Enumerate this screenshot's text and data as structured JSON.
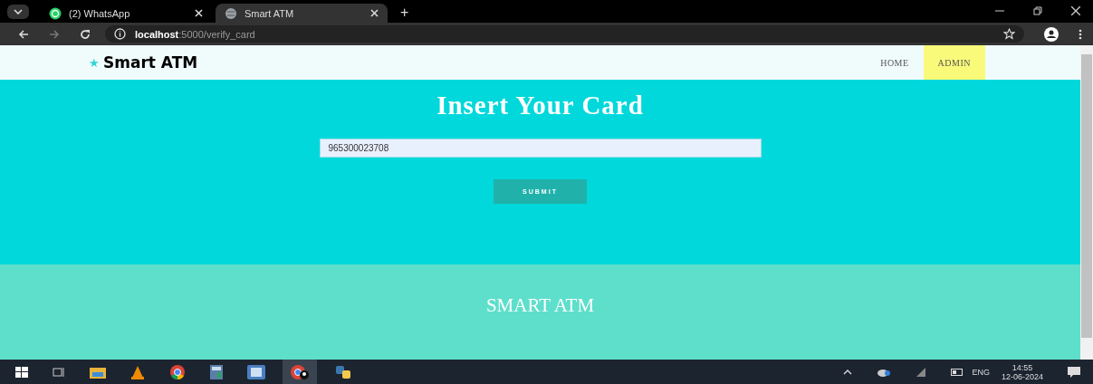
{
  "browser": {
    "tabs": [
      {
        "title": "(2) WhatsApp",
        "selected": false
      },
      {
        "title": "Smart ATM",
        "selected": true
      }
    ],
    "new_tab": "+",
    "address": {
      "host": "localhost",
      "path": ":5000/verify_card"
    }
  },
  "navbar": {
    "logo_mark": "★",
    "logo": "Smart ATM",
    "links": [
      {
        "label": "HOME",
        "selected": false
      },
      {
        "label": "ADMIN",
        "selected": true
      }
    ]
  },
  "card_form": {
    "title": "Insert Your Card",
    "card_number": "965300023708",
    "submit": "SUBMIT"
  },
  "footer": {
    "text": "SMART ATM"
  },
  "taskbar": {
    "language": "ENG",
    "time": "14:55",
    "date": "12-06-2024"
  }
}
